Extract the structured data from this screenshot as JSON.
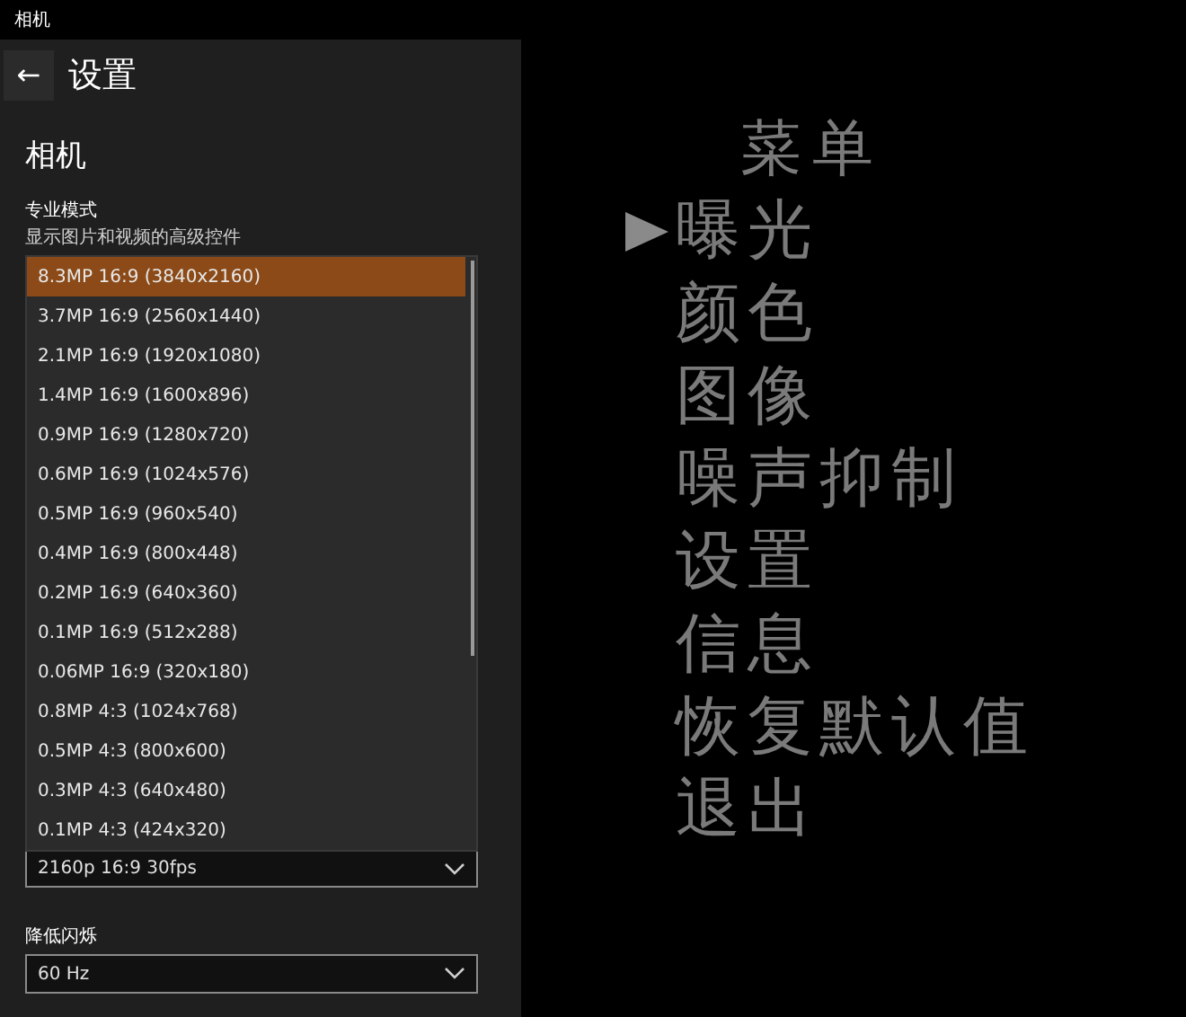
{
  "window": {
    "title": "相机"
  },
  "header": {
    "back_label": "←",
    "title": "设置"
  },
  "section": {
    "title": "相机"
  },
  "pro_mode": {
    "label": "专业模式",
    "description": "显示图片和视频的高级控件"
  },
  "resolution_list": [
    {
      "label": "8.3MP 16:9 (3840x2160)",
      "selected": true
    },
    {
      "label": "3.7MP 16:9 (2560x1440)",
      "selected": false
    },
    {
      "label": "2.1MP 16:9 (1920x1080)",
      "selected": false
    },
    {
      "label": "1.4MP 16:9 (1600x896)",
      "selected": false
    },
    {
      "label": "0.9MP 16:9 (1280x720)",
      "selected": false
    },
    {
      "label": "0.6MP 16:9 (1024x576)",
      "selected": false
    },
    {
      "label": "0.5MP 16:9 (960x540)",
      "selected": false
    },
    {
      "label": "0.4MP 16:9 (800x448)",
      "selected": false
    },
    {
      "label": "0.2MP 16:9 (640x360)",
      "selected": false
    },
    {
      "label": "0.1MP 16:9 (512x288)",
      "selected": false
    },
    {
      "label": "0.06MP 16:9 (320x180)",
      "selected": false
    },
    {
      "label": "0.8MP 4:3 (1024x768)",
      "selected": false
    },
    {
      "label": "0.5MP 4:3 (800x600)",
      "selected": false
    },
    {
      "label": "0.3MP 4:3 (640x480)",
      "selected": false
    },
    {
      "label": "0.1MP 4:3 (424x320)",
      "selected": false
    }
  ],
  "video_quality": {
    "value": "2160p 16:9 30fps"
  },
  "flicker": {
    "label": "降低闪烁",
    "value": "60 Hz"
  },
  "osd_menu": {
    "title": "菜单",
    "items": [
      {
        "label": "曝光",
        "selected": true
      },
      {
        "label": "颜色",
        "selected": false
      },
      {
        "label": "图像",
        "selected": false
      },
      {
        "label": "噪声抑制",
        "selected": false
      },
      {
        "label": "设置",
        "selected": false
      },
      {
        "label": "信息",
        "selected": false
      },
      {
        "label": "恢复默认值",
        "selected": false
      },
      {
        "label": "退出",
        "selected": false
      }
    ]
  }
}
